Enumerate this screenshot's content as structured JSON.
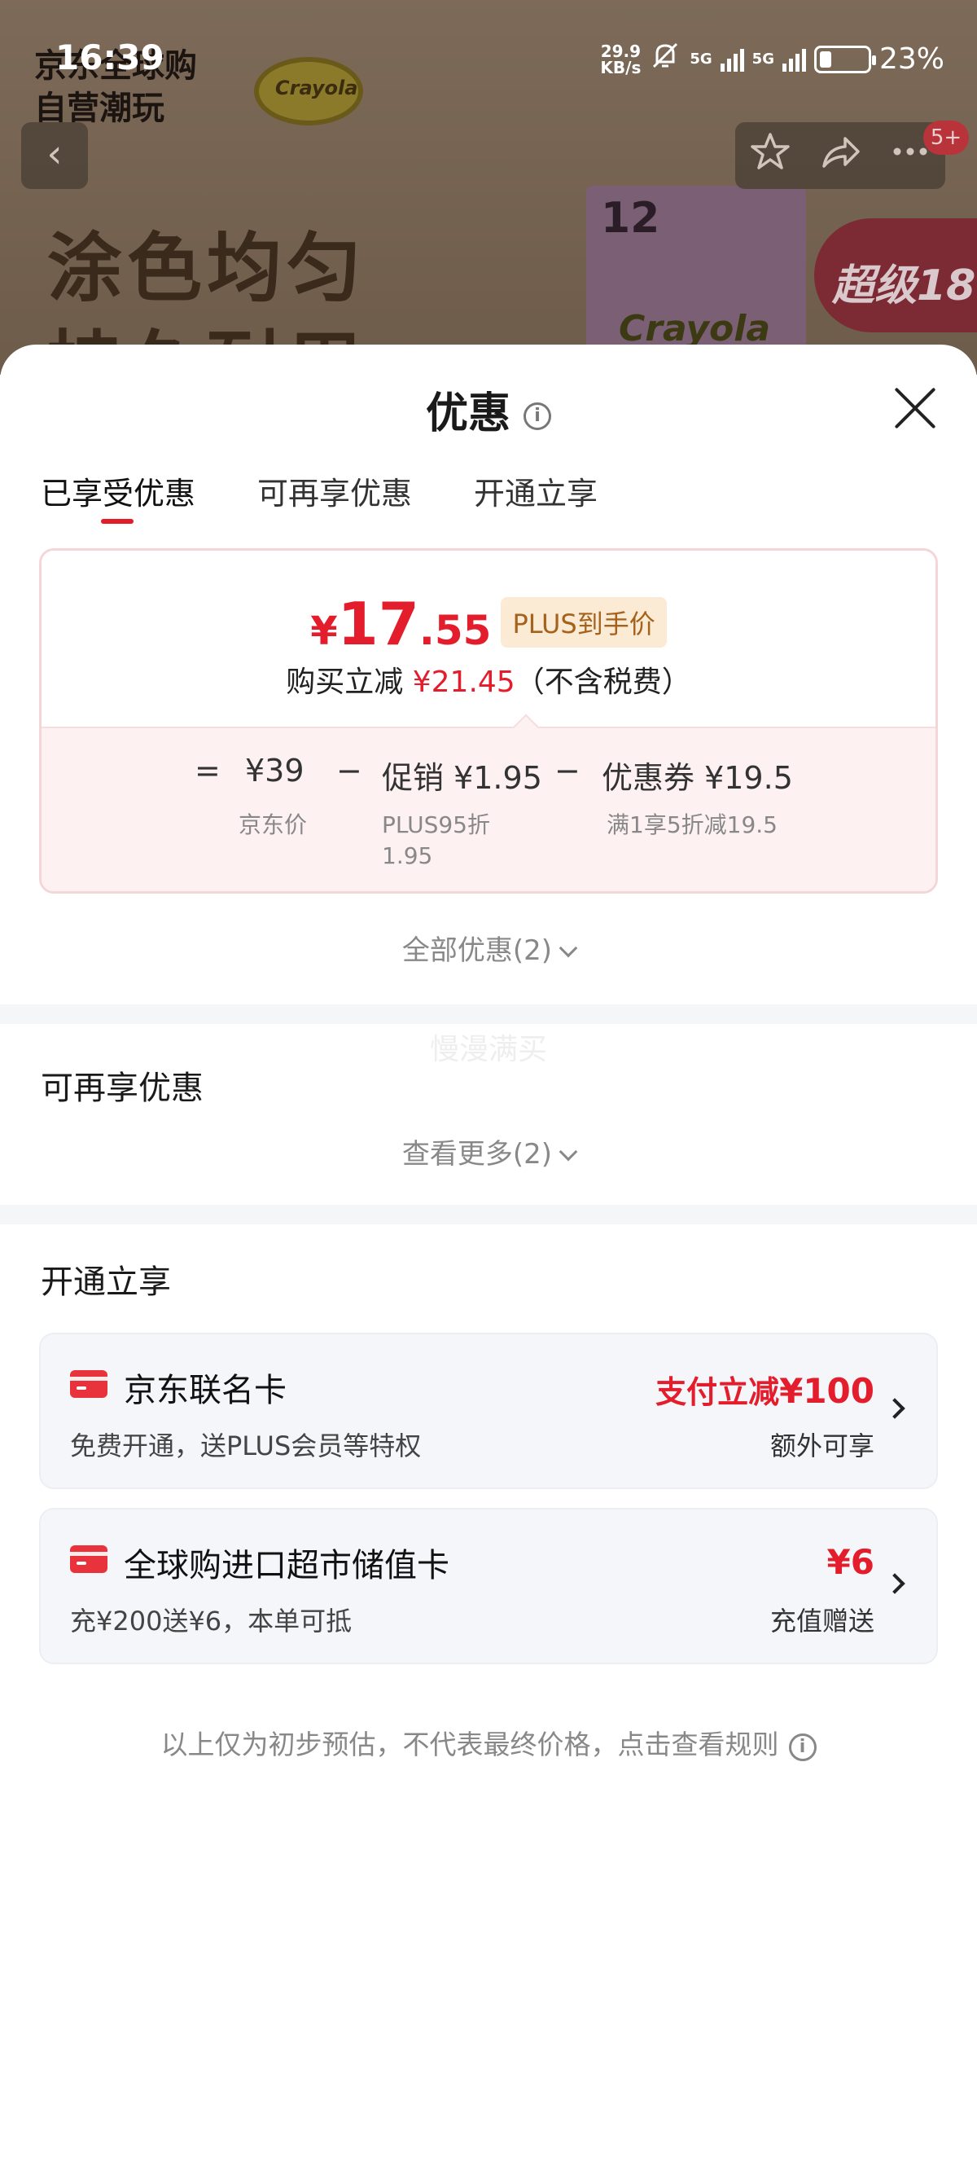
{
  "status_bar": {
    "time": "16:39",
    "net_speed_value": "29.9",
    "net_speed_unit": "KB/s",
    "signal_1": "5G",
    "signal_2": "5G",
    "battery": "23%"
  },
  "background_page": {
    "brand_line1": "京东全球购",
    "brand_line2": "自营潮玩",
    "logo_text": "Crayola",
    "slogan_line1": "涂色均匀",
    "slogan_line2": "持久耐用",
    "box_number": "12",
    "box_brand": "Crayola",
    "promo_badge": "超级18",
    "notification_count": "5+"
  },
  "sheet": {
    "title": "优惠",
    "tabs": [
      {
        "label": "已享受优惠"
      },
      {
        "label": "可再享优惠"
      },
      {
        "label": "开通立享"
      }
    ],
    "price": {
      "currency": "¥",
      "integer": "17",
      "decimal": ".55",
      "tag": "PLUS到手价",
      "reduce_prefix": "购买立减",
      "reduce_amount": "¥21.45",
      "reduce_suffix": "（不含税费）"
    },
    "formula": {
      "equals": "=",
      "base_value": "¥39",
      "base_label": "京东价",
      "minus1": "−",
      "promo_value": "促销 ¥1.95",
      "promo_label": "PLUS95折",
      "promo_label2": "1.95",
      "minus2": "−",
      "coupon_value": "优惠券 ¥19.5",
      "coupon_label": "满1享5折减19.5"
    },
    "all_discounts": "全部优惠(2)",
    "watermark": "慢漫满买",
    "more_section_title": "可再享优惠",
    "see_more": "查看更多(2)",
    "open_section_title": "开通立享",
    "cards": [
      {
        "title": "京东联名卡",
        "subtitle": "免费开通，送PLUS会员等特权",
        "right_prefix": "支付立减",
        "right_amount": "¥100",
        "right_sub": "额外可享"
      },
      {
        "title": "全球购进口超市储值卡",
        "subtitle": "充¥200送¥6，本单可抵",
        "right_prefix": "",
        "right_amount": "¥6",
        "right_sub": "充值赠送"
      }
    ],
    "footnote": "以上仅为初步预估，不代表最终价格，点击查看规则"
  },
  "colors": {
    "accent_red": "#e31d2b",
    "plus_tag_bg": "#fbead4",
    "plus_tag_text": "#a5621c",
    "card_bg": "#f5f6fa"
  }
}
